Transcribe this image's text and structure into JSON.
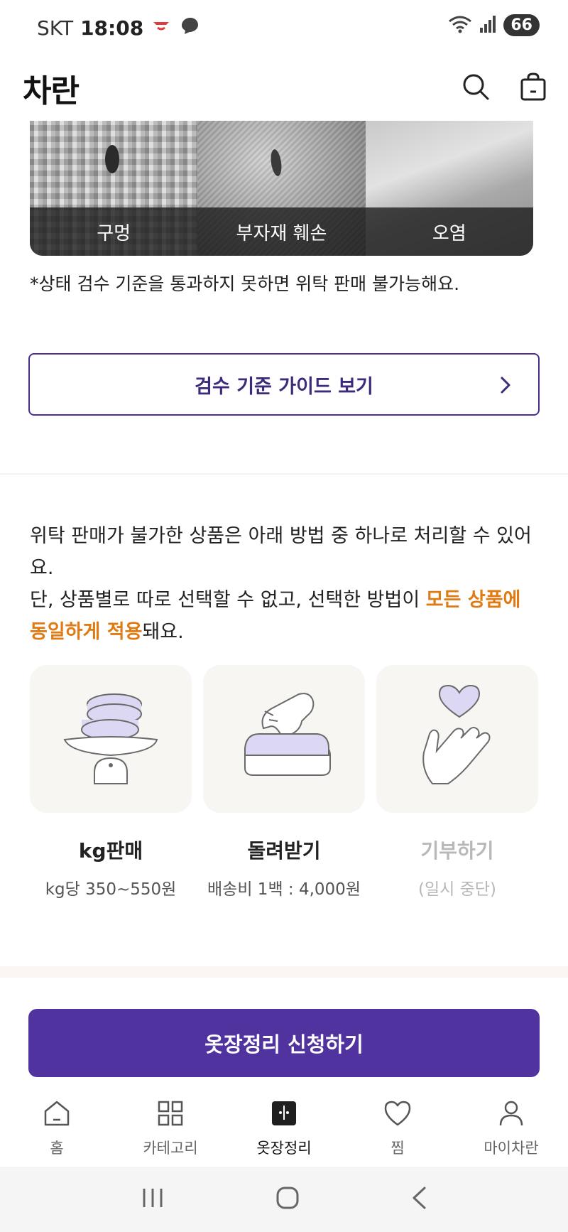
{
  "status_bar": {
    "carrier": "SKT",
    "time": "18:08",
    "battery": "66"
  },
  "header": {
    "brand": "차란"
  },
  "defects": [
    {
      "label": "구멍"
    },
    {
      "label": "부자재 훼손"
    },
    {
      "label": "오염"
    }
  ],
  "note": "*상태 검수 기준을 통과하지 못하면 위탁 판매 불가능해요.",
  "guide_button": {
    "label": "검수 기준 가이드 보기"
  },
  "description": {
    "line1": "위탁 판매가 불가한 상품은 아래 방법 중 하나로 처리할 수 있어요.",
    "line2_prefix": "단, 상품별로 따로 선택할 수 없고, 선택한 방법이 ",
    "highlight": "모든 상품에 동일하게 적용",
    "line2_suffix": "돼요."
  },
  "options": [
    {
      "title": "kg판매",
      "subtitle": "kg당 350~550원"
    },
    {
      "title": "돌려받기",
      "subtitle": "배송비 1백 : 4,000원"
    },
    {
      "title": "기부하기",
      "subtitle": "(일시 중단)"
    }
  ],
  "apply_button": {
    "label": "옷장정리 신청하기"
  },
  "bottom_nav": [
    {
      "label": "홈",
      "icon": "home-icon"
    },
    {
      "label": "카테고리",
      "icon": "grid-icon"
    },
    {
      "label": "옷장정리",
      "icon": "closet-icon"
    },
    {
      "label": "찜",
      "icon": "heart-icon"
    },
    {
      "label": "마이차란",
      "icon": "person-icon"
    }
  ],
  "colors": {
    "brand_purple": "#5133a0",
    "highlight_orange": "#e07b14",
    "card_bg": "#f7f6f3"
  }
}
